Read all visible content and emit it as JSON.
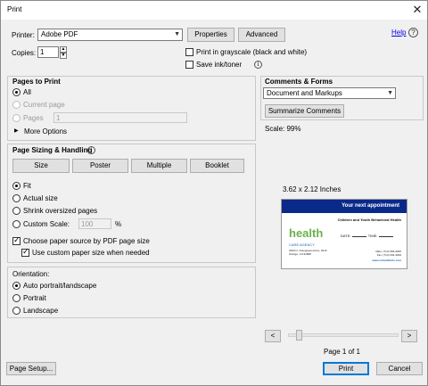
{
  "window": {
    "title": "Print",
    "close_glyph": "✕"
  },
  "top": {
    "printer_label": "Printer:",
    "printer_value": "Adobe PDF",
    "properties_label": "Properties",
    "advanced_label": "Advanced",
    "help_label": "Help",
    "copies_label": "Copies:",
    "copies_value": "1",
    "grayscale_label": "Print in grayscale (black and white)",
    "grayscale_checked": false,
    "saveink_label": "Save ink/toner",
    "saveink_checked": false
  },
  "pages_to_print": {
    "header": "Pages to Print",
    "all_label": "All",
    "current_label": "Current page",
    "pages_label": "Pages",
    "pages_value": "1",
    "more_options_label": "More Options",
    "selected": "All"
  },
  "sizing": {
    "header": "Page Sizing & Handling",
    "tabs": [
      "Size",
      "Poster",
      "Multiple",
      "Booklet"
    ],
    "fit_label": "Fit",
    "actual_label": "Actual size",
    "shrink_label": "Shrink oversized pages",
    "custom_label": "Custom Scale:",
    "custom_value": "100",
    "percent": "%",
    "selected": "Fit",
    "choose_source_label": "Choose paper source by PDF page size",
    "choose_source_checked": true,
    "custom_paper_label": "Use custom paper size when needed",
    "custom_paper_checked": true
  },
  "orientation": {
    "header": "Orientation:",
    "auto_label": "Auto portrait/landscape",
    "portrait_label": "Portrait",
    "landscape_label": "Landscape",
    "selected": "Auto portrait/landscape"
  },
  "comments": {
    "header": "Comments & Forms",
    "select_value": "Document and Markups",
    "summarize_label": "Summarize Comments",
    "scale_text": "Scale:  99%"
  },
  "preview": {
    "size_text": "3.62 x 2.12 Inches",
    "card": {
      "headline": "Your next appointment",
      "subtitle": "Children and Youth Behavioral Health",
      "date_label": "DATE:",
      "time_label": "TIME:",
      "logo_text": "health",
      "care_text": "CARE AGENCY",
      "address": "2200 N. Orangewood Ave, #212 Orange, CA 92868",
      "phone": "Main: (714) 665-9045",
      "fax": "Fax: (714) 634-3029",
      "web": "www.ochealthinfo.com"
    },
    "page_indicator": "Page 1 of 1",
    "prev_glyph": "<",
    "next_glyph": ">"
  },
  "footer": {
    "page_setup_label": "Page Setup...",
    "print_label": "Print",
    "cancel_label": "Cancel"
  }
}
